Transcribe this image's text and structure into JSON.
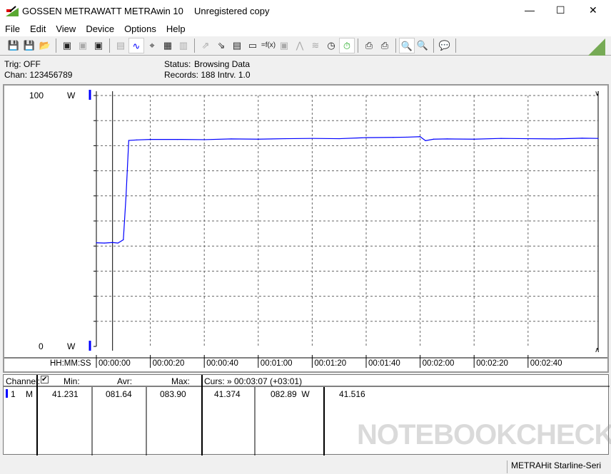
{
  "window": {
    "brand": "GOSSEN METRAWATT",
    "app": "METRAwin 10",
    "license": "Unregistered copy",
    "controls": [
      "—",
      "☐",
      "✕"
    ]
  },
  "menu": [
    "File",
    "Edit",
    "View",
    "Device",
    "Options",
    "Help"
  ],
  "toolbar_icons": [
    "save-icon",
    "save-as-icon",
    "open-folder-icon",
    "device-read-icon",
    "device-clear-icon",
    "device-memory-icon",
    "digital-display-icon",
    "waveform-icon",
    "crosshair-icon",
    "table-icon",
    "bars-icon",
    "export-icon",
    "import-icon",
    "protocol-icon",
    "monitor-icon",
    "function-icon",
    "device-icon",
    "trigger-icon",
    "sampling-icon",
    "clock-icon",
    "stopwatch-icon",
    "print-icon",
    "printer-icon",
    "zoom-wave-icon",
    "zoom-cursor-icon",
    "comment-icon"
  ],
  "info": {
    "trig": "Trig: OFF",
    "chan": "Chan:  123456789",
    "status_label": "Status:",
    "status_value": "Browsing Data",
    "records": "Records: 188  Intrv. 1.0"
  },
  "chart_data": {
    "type": "line",
    "ylabel_top": "100",
    "ylabel_bottom": "0",
    "yunit": "W",
    "ylim": [
      0,
      100
    ],
    "xlim": [
      0,
      186
    ],
    "xlabel": "HH:MM:SS",
    "x_ticks": [
      "00:00:00",
      "00:00:20",
      "00:00:40",
      "00:01:00",
      "00:01:20",
      "00:01:40",
      "00:02:00",
      "00:02:20",
      "00:02:40"
    ],
    "grid": true,
    "cursor_x": 6,
    "series": [
      {
        "color": "#0000ff",
        "x": [
          0,
          3,
          6,
          8,
          10,
          11,
          12,
          15,
          20,
          30,
          40,
          50,
          60,
          70,
          80,
          90,
          100,
          110,
          115,
          120,
          122,
          125,
          130,
          140,
          150,
          160,
          170,
          180,
          186
        ],
        "y": [
          41.3,
          41.2,
          41.4,
          41.2,
          42.5,
          60,
          82.1,
          82.3,
          82.5,
          82.5,
          82.4,
          82.7,
          82.6,
          82.8,
          82.9,
          82.8,
          83.2,
          83.3,
          83.4,
          83.6,
          82.0,
          82.6,
          82.7,
          82.6,
          82.9,
          82.8,
          82.7,
          83.0,
          82.9
        ]
      }
    ]
  },
  "table": {
    "channel_label": "Channel:",
    "min_label": "Min:",
    "avr_label": "Avr:",
    "max_label": "Max:",
    "curs_label": "Curs: » 00:03:07 (+03:01)",
    "row": {
      "num": "1",
      "mode": "M",
      "min": "41.231",
      "avr": "081.64",
      "max": "083.90",
      "c1": "41.374",
      "c2": "082.89  W",
      "c3": "41.516"
    }
  },
  "statusbar": "METRAHit Starline-Seri",
  "watermark": "NOTEBOOKCHECK"
}
